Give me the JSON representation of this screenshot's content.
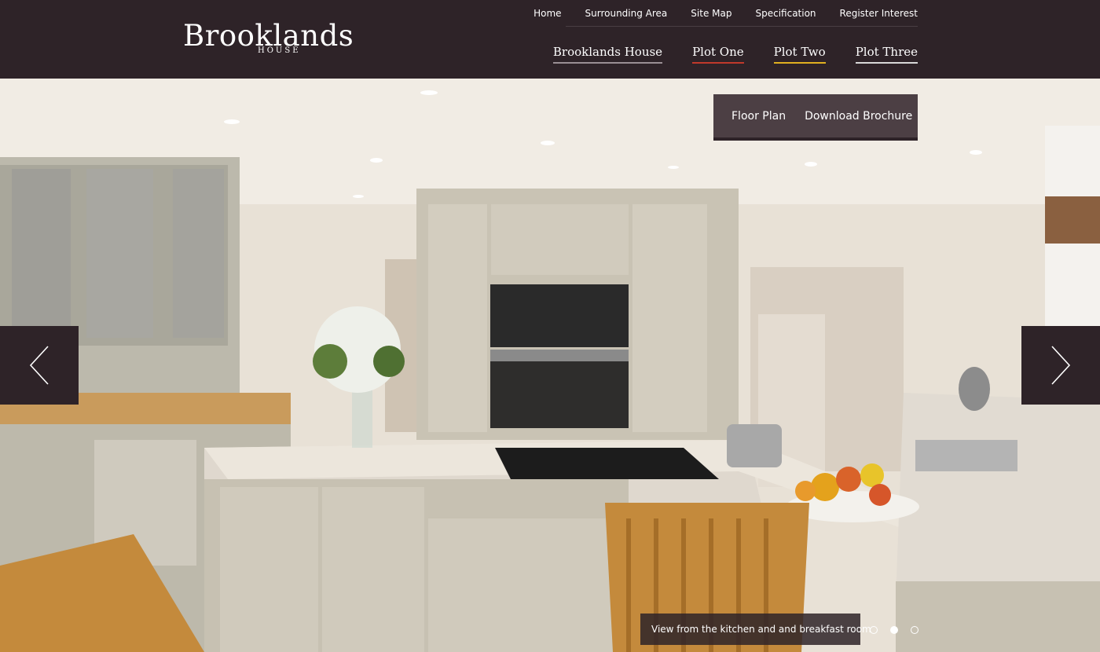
{
  "site": {
    "logo_main": "Brooklands",
    "logo_sub": "HOUSE"
  },
  "topnav": [
    {
      "label": "Home"
    },
    {
      "label": "Surrounding  Area"
    },
    {
      "label": "Site Map"
    },
    {
      "label": "Specification"
    },
    {
      "label": "Register Interest"
    }
  ],
  "mainnav": [
    {
      "label": "Brooklands House",
      "underline_color": "#9a8f94"
    },
    {
      "label": "Plot One",
      "underline_color": "#c0392b"
    },
    {
      "label": "Plot Two",
      "underline_color": "#e0b020"
    },
    {
      "label": "Plot Three",
      "underline_color": "#d9d9d9"
    }
  ],
  "actions": {
    "floor_plan": "Floor Plan",
    "download_brochure": "Download Brochure"
  },
  "slider": {
    "caption": "View from the kitchen and and breakfast room",
    "slide_count": 3,
    "active_slide": 2,
    "prev_icon": "chevron-left-icon",
    "next_icon": "chevron-right-icon"
  },
  "colors": {
    "header_bg": "#2e2328",
    "panel_bg": "#3e3036"
  }
}
